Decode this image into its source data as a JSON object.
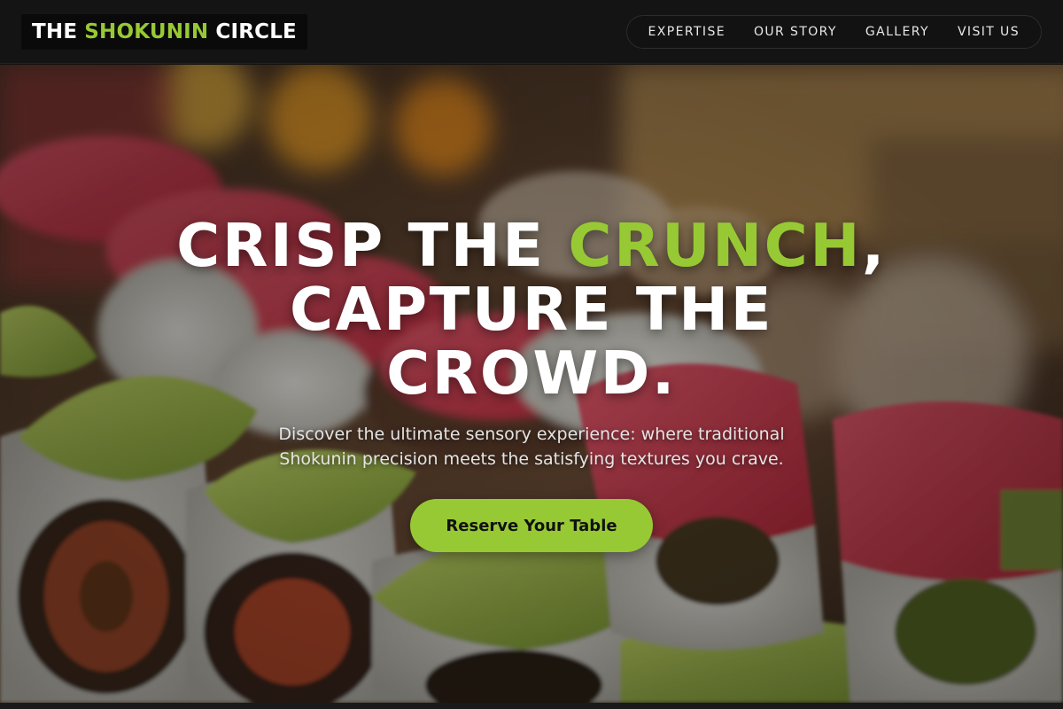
{
  "brand": {
    "prefix": "THE",
    "highlight": "SHOKUNIN",
    "suffix": "CIRCLE",
    "accent_color": "#97c934"
  },
  "nav": {
    "items": [
      {
        "label": "EXPERTISE"
      },
      {
        "label": "OUR STORY"
      },
      {
        "label": "GALLERY"
      },
      {
        "label": "VISIT US"
      }
    ]
  },
  "hero": {
    "headline_part1": "CRISP THE ",
    "headline_highlight": "CRUNCH",
    "headline_part2": ",",
    "headline_line2": "CAPTURE THE",
    "headline_line3": "CROWD.",
    "subtext": "Discover the ultimate sensory experience: where traditional Shokunin precision meets the satisfying textures you crave.",
    "cta_label": "Reserve Your Table",
    "background_image": "sushi-rolls-photo"
  }
}
